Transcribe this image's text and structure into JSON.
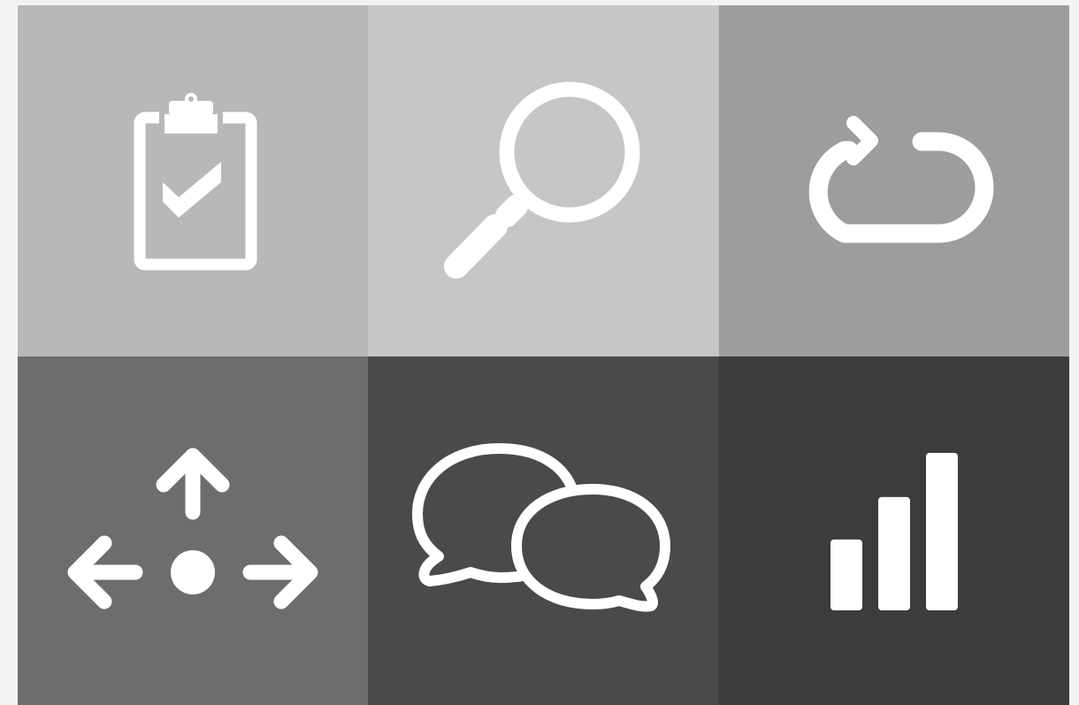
{
  "tiles": [
    {
      "id": "checklist",
      "icon": "clipboard-check-icon",
      "color": "#b7b8ba"
    },
    {
      "id": "search",
      "icon": "magnifying-glass-icon",
      "color": "#c5c6c5"
    },
    {
      "id": "loop",
      "icon": "loop-arrow-icon",
      "color": "#9c9d9c"
    },
    {
      "id": "directions",
      "icon": "multidirectional-arrows-icon",
      "color": "#6d6d6b"
    },
    {
      "id": "chat",
      "icon": "speech-bubbles-icon",
      "color": "#4a4a48"
    },
    {
      "id": "stats",
      "icon": "bar-chart-icon",
      "color": "#3c3c3a"
    }
  ],
  "stats_bars": [
    0.45,
    0.72,
    1.0
  ]
}
